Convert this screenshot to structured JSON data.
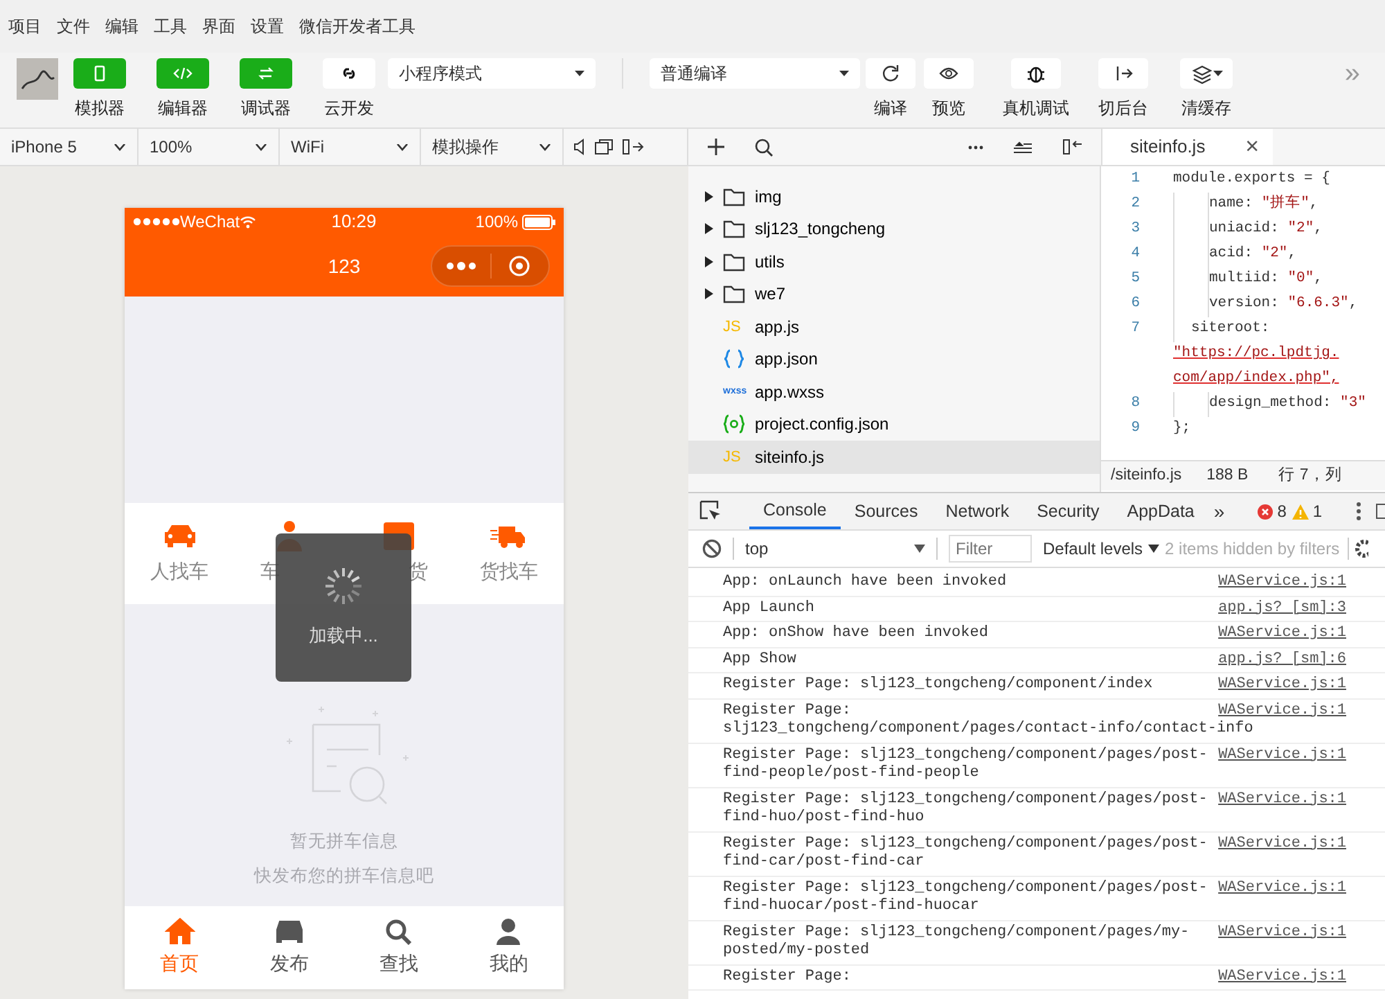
{
  "menu": [
    "项目",
    "文件",
    "编辑",
    "工具",
    "界面",
    "设置",
    "微信开发者工具"
  ],
  "toolbar": {
    "tools": [
      {
        "kind": "green",
        "label": "模拟器"
      },
      {
        "kind": "green",
        "label": "编辑器"
      },
      {
        "kind": "green",
        "label": "调试器"
      },
      {
        "kind": "plain",
        "label": "云开发"
      }
    ],
    "mode_select": "小程序模式",
    "compile_select": "普通编译",
    "actions": [
      {
        "label": "编译"
      },
      {
        "label": "预览"
      },
      {
        "label": "真机调试"
      },
      {
        "label": "切后台"
      },
      {
        "label": "清缓存"
      }
    ],
    "more": "»"
  },
  "device_bar": [
    "iPhone 5",
    "100%",
    "WiFi",
    "模拟操作"
  ],
  "phone": {
    "carrier": "WeChat",
    "time": "10:29",
    "battery": "100%",
    "title": "123",
    "categories": [
      {
        "label": "人找车",
        "kind": "whole"
      },
      {
        "label": "车",
        "kind": "headpart"
      },
      {
        "label": "货",
        "kind": "tailpart"
      },
      {
        "label": "货找车",
        "kind": "whole"
      }
    ],
    "toast": "加载中...",
    "empty": [
      "暂无拼车信息",
      "快发布您的拼车信息吧"
    ],
    "tabbar": [
      {
        "label": "首页",
        "selected": true
      },
      {
        "label": "发布",
        "selected": false
      },
      {
        "label": "查找",
        "selected": false
      },
      {
        "label": "我的",
        "selected": false
      }
    ]
  },
  "explorer": {
    "items": [
      {
        "name": "img",
        "kind": "folder",
        "selected": false
      },
      {
        "name": "slj123_tongcheng",
        "kind": "folder",
        "selected": false
      },
      {
        "name": "utils",
        "kind": "folder",
        "selected": false
      },
      {
        "name": "we7",
        "kind": "folder",
        "selected": false
      },
      {
        "name": "app.js",
        "kind": "js",
        "badge": "JS",
        "selected": false
      },
      {
        "name": "app.json",
        "kind": "json",
        "selected": false
      },
      {
        "name": "app.wxss",
        "kind": "wxss",
        "badge": "wxss",
        "selected": false
      },
      {
        "name": "project.config.json",
        "kind": "config",
        "selected": false
      },
      {
        "name": "siteinfo.js",
        "kind": "js",
        "badge": "JS",
        "selected": true
      }
    ]
  },
  "editor": {
    "tab": "siteinfo.js",
    "close": "×",
    "lines": [
      {
        "number": "1",
        "kind": "top",
        "text": "module.exports = {"
      },
      {
        "number": "2",
        "kind": "inner",
        "text": "name: \"拼车\","
      },
      {
        "number": "3",
        "kind": "inner",
        "text": "uniacid: \"2\","
      },
      {
        "number": "4",
        "kind": "inner",
        "text": "acid: \"2\","
      },
      {
        "number": "5",
        "kind": "inner",
        "text": "multiid: \"0\","
      },
      {
        "number": "6",
        "kind": "inner",
        "text": "version: \"6.6.3\","
      },
      {
        "number": "7",
        "kind": "mid",
        "text": "siteroot:"
      },
      {
        "kind": "wrap",
        "text": "\"https://pc.lpdtjg."
      },
      {
        "kind": "wrap",
        "text": "com/app/index.php\","
      },
      {
        "number": "8",
        "kind": "inner",
        "text": "design_method: \"3\""
      },
      {
        "number": "9",
        "kind": "top",
        "text": "};"
      }
    ],
    "status": {
      "path": "/siteinfo.js",
      "size": "188 B",
      "position": "行 7，列"
    }
  },
  "devtools": {
    "tabs": [
      {
        "label": "Console",
        "selected": true
      },
      {
        "label": "Sources",
        "selected": false
      },
      {
        "label": "Network",
        "selected": false
      },
      {
        "label": "Security",
        "selected": false
      },
      {
        "label": "AppData",
        "selected": false
      }
    ],
    "more": "»",
    "errors": "8",
    "warnings": "1",
    "context": "top",
    "filter_placeholder": "Filter",
    "levels": "Default levels",
    "hidden": "2 items hidden by filters",
    "logs": [
      {
        "lines": [
          "App: onLaunch have been invoked"
        ],
        "source": "WAService.js:1"
      },
      {
        "lines": [
          "App Launch"
        ],
        "source": "app.js? [sm]:3"
      },
      {
        "lines": [
          "App: onShow have been invoked"
        ],
        "source": "WAService.js:1"
      },
      {
        "lines": [
          "App Show"
        ],
        "source": "app.js? [sm]:6"
      },
      {
        "lines": [
          "Register Page: slj123_tongcheng/component/index"
        ],
        "source": "WAService.js:1"
      },
      {
        "lines": [
          "Register Page:",
          "slj123_tongcheng/component/pages/contact-info/contact-info"
        ],
        "source": "WAService.js:1"
      },
      {
        "lines": [
          "Register Page: slj123_tongcheng/component/pages/post-",
          "find-people/post-find-people"
        ],
        "source": "WAService.js:1"
      },
      {
        "lines": [
          "Register Page: slj123_tongcheng/component/pages/post-",
          "find-huo/post-find-huo"
        ],
        "source": "WAService.js:1"
      },
      {
        "lines": [
          "Register Page: slj123_tongcheng/component/pages/post-",
          "find-car/post-find-car"
        ],
        "source": "WAService.js:1"
      },
      {
        "lines": [
          "Register Page: slj123_tongcheng/component/pages/post-",
          "find-huocar/post-find-huocar"
        ],
        "source": "WAService.js:1"
      },
      {
        "lines": [
          "Register Page: slj123_tongcheng/component/pages/my-",
          "posted/my-posted"
        ],
        "source": "WAService.js:1"
      },
      {
        "lines": [
          "Register Page:"
        ],
        "source": "WAService.js:1"
      }
    ]
  }
}
